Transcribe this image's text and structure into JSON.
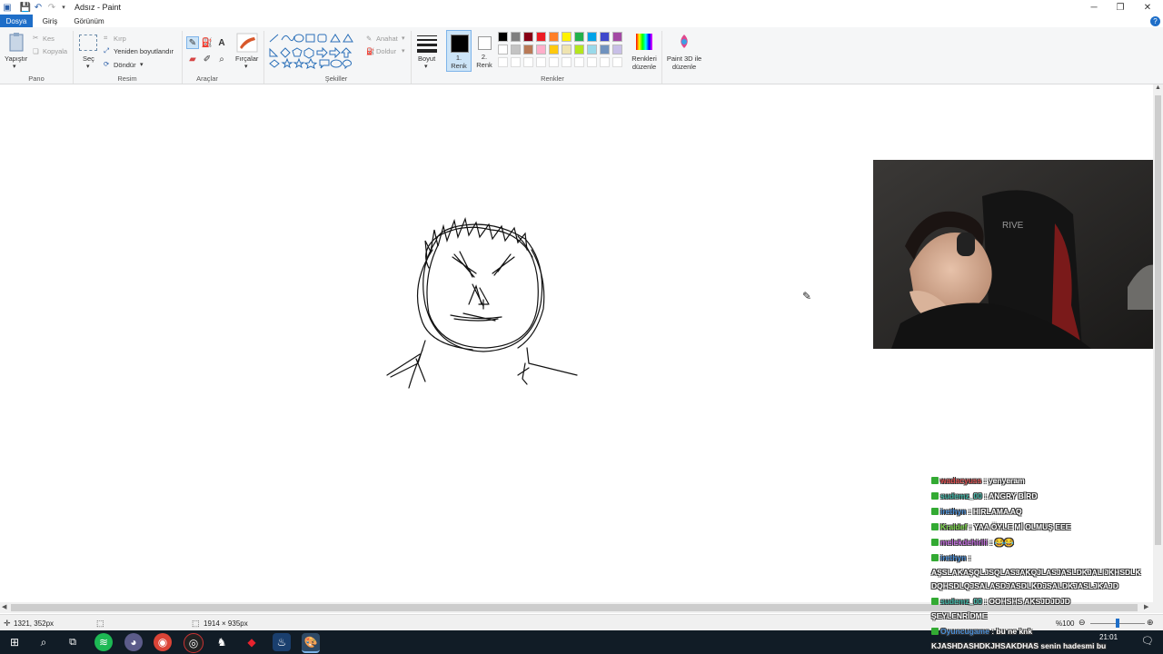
{
  "window": {
    "title": "Adsız - Paint"
  },
  "tabs": {
    "file": "Dosya",
    "home": "Giriş",
    "view": "Görünüm"
  },
  "ribbon": {
    "clipboard": {
      "paste": "Yapıştır",
      "cut": "Kes",
      "copy": "Kopyala",
      "group": "Pano"
    },
    "image": {
      "select": "Seç",
      "crop": "Kırp",
      "resize": "Yeniden boyutlandır",
      "rotate": "Döndür",
      "group": "Resim"
    },
    "tools": {
      "group": "Araçlar"
    },
    "brushes": {
      "label": "Fırçalar"
    },
    "shapes": {
      "outline": "Anahat",
      "fill": "Doldur",
      "group": "Şekiller"
    },
    "size": {
      "label": "Boyut"
    },
    "colors": {
      "color1_line1": "1.",
      "color1_line2": "Renk",
      "color2_line1": "2.",
      "color2_line2": "Renk",
      "edit_line1": "Renkleri",
      "edit_line2": "düzenle",
      "paint3d_line1": "Paint 3D ile",
      "paint3d_line2": "düzenle",
      "group": "Renkler",
      "palette_row1": [
        "#000000",
        "#7f7f7f",
        "#880015",
        "#ed1c24",
        "#ff7f27",
        "#fff200",
        "#22b14c",
        "#00a2e8",
        "#3f48cc",
        "#a349a4"
      ],
      "palette_row2": [
        "#ffffff",
        "#c3c3c3",
        "#b97a57",
        "#ffaec9",
        "#ffc90e",
        "#efe4b0",
        "#b5e61d",
        "#99d9ea",
        "#7092be",
        "#c8bfe7"
      ]
    }
  },
  "status": {
    "cursor": "1321, 352px",
    "size": "1914 × 935px",
    "zoom": "%100"
  },
  "taskbar": {
    "time": "21:01"
  },
  "chat": [
    {
      "user": "wadacyuss",
      "msg": ": yenyeram",
      "color": "#d84a4a"
    },
    {
      "user": "sudemz_00",
      "msg": ": ANGRY BİRD",
      "color": "#3fb7a7"
    },
    {
      "user": "irethyn",
      "msg": ": HIRLAMA AQ",
      "color": "#4a8fd8"
    },
    {
      "user": "Kraldef",
      "msg": ": YAA ÖYLE Mİ OLMUŞ EEE",
      "color": "#7bd84a"
    },
    {
      "user": "melekdehirlii",
      "msg": ": 😂😂",
      "color": "#c46be0"
    },
    {
      "user": "irethyn",
      "msg": ":",
      "color": "#4a8fd8"
    },
    {
      "user": "",
      "msg": "AŞSLAKAŞQLJSQLAS3AKQJLASJASLDKJALIJKHSDLK",
      "color": ""
    },
    {
      "user": "",
      "msg": "DQHSDLQJSALASDJASDLKDJSALDKJASLJKAJD",
      "color": ""
    },
    {
      "user": "sudemz_00",
      "msg": ": OOHSHS AKSJDJDJD",
      "color": "#3fb7a7"
    },
    {
      "user": "",
      "msg": "ŞEYLENRİDME",
      "color": ""
    },
    {
      "user": "Oyuncugame",
      "msg": ": bu ne knk",
      "color": "#4a8fd8"
    },
    {
      "user": "",
      "msg": "KJASHDASHDKJHSAKDHAS senin hadesmi bu",
      "color": ""
    }
  ]
}
